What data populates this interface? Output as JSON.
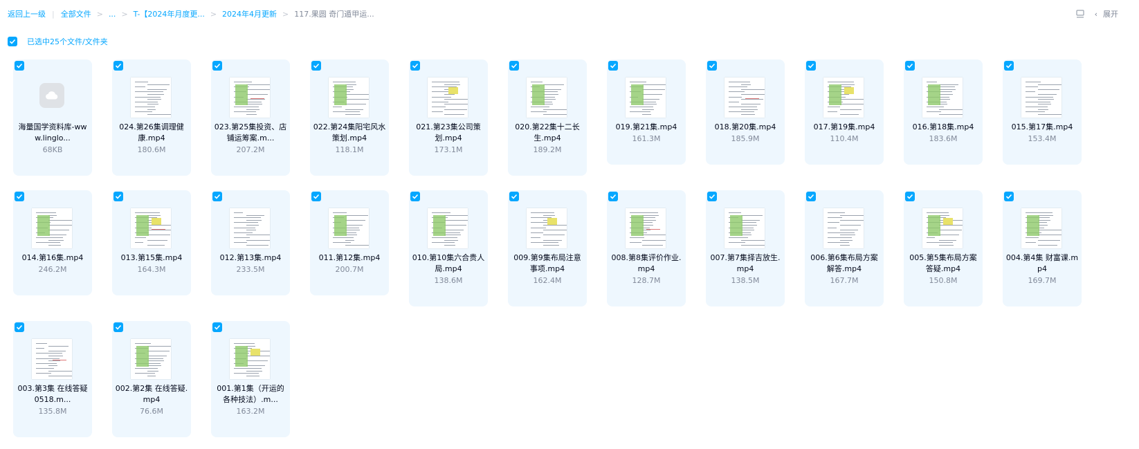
{
  "breadcrumb": {
    "back": "返回上一级",
    "root": "全部文件",
    "ellipsis": "...",
    "level1": "T-【2024年月度更...",
    "level2": "2024年4月更新",
    "current": "117.果圆 奇门遁甲运..."
  },
  "tools": {
    "expand_label": "展开"
  },
  "selection": {
    "text": "已选中25个文件/文件夹"
  },
  "files": [
    {
      "name": "海量国学资料库-www.linglo...",
      "size": "68KB"
    },
    {
      "name": "024.第26集调理健康.mp4",
      "size": "180.6M"
    },
    {
      "name": "023.第25集投资、店铺运筹案.m...",
      "size": "207.2M"
    },
    {
      "name": "022.第24集阳宅风水策划.mp4",
      "size": "118.1M"
    },
    {
      "name": "021.第23集公司策划.mp4",
      "size": "173.1M"
    },
    {
      "name": "020.第22集十二长生.mp4",
      "size": "189.2M"
    },
    {
      "name": "019.第21集.mp4",
      "size": "161.3M"
    },
    {
      "name": "018.第20集.mp4",
      "size": "185.9M"
    },
    {
      "name": "017.第19集.mp4",
      "size": "110.4M"
    },
    {
      "name": "016.第18集.mp4",
      "size": "183.6M"
    },
    {
      "name": "015.第17集.mp4",
      "size": "153.4M"
    },
    {
      "name": "014.第16集.mp4",
      "size": "246.2M"
    },
    {
      "name": "013.第15集.mp4",
      "size": "164.3M"
    },
    {
      "name": "012.第13集.mp4",
      "size": "233.5M"
    },
    {
      "name": "011.第12集.mp4",
      "size": "200.7M"
    },
    {
      "name": "010.第10集六合贵人局.mp4",
      "size": "138.6M"
    },
    {
      "name": "009.第9集布局注意事项.mp4",
      "size": "162.4M"
    },
    {
      "name": "008.第8集评价作业.mp4",
      "size": "128.7M"
    },
    {
      "name": "007.第7集择吉放生.mp4",
      "size": "138.5M"
    },
    {
      "name": "006.第6集布局方案解答.mp4",
      "size": "167.7M"
    },
    {
      "name": "005.第5集布局方案答疑.mp4",
      "size": "150.8M"
    },
    {
      "name": "004.第4集 财富课.mp4",
      "size": "169.7M"
    },
    {
      "name": "003.第3集 在线答疑0518.m...",
      "size": "135.8M"
    },
    {
      "name": "002.第2集 在线答疑.mp4",
      "size": "76.6M"
    },
    {
      "name": "001.第1集（开运的各种技法）.m...",
      "size": "163.2M"
    }
  ],
  "colors": {
    "accent": "#06a7ff",
    "card_bg": "#eef7fe",
    "muted": "#818999"
  },
  "icons": {
    "checkbox": "check-icon",
    "list_view": "list-view-icon",
    "chevron": "chevron-left-icon",
    "cloud": "cloud-file-icon"
  }
}
